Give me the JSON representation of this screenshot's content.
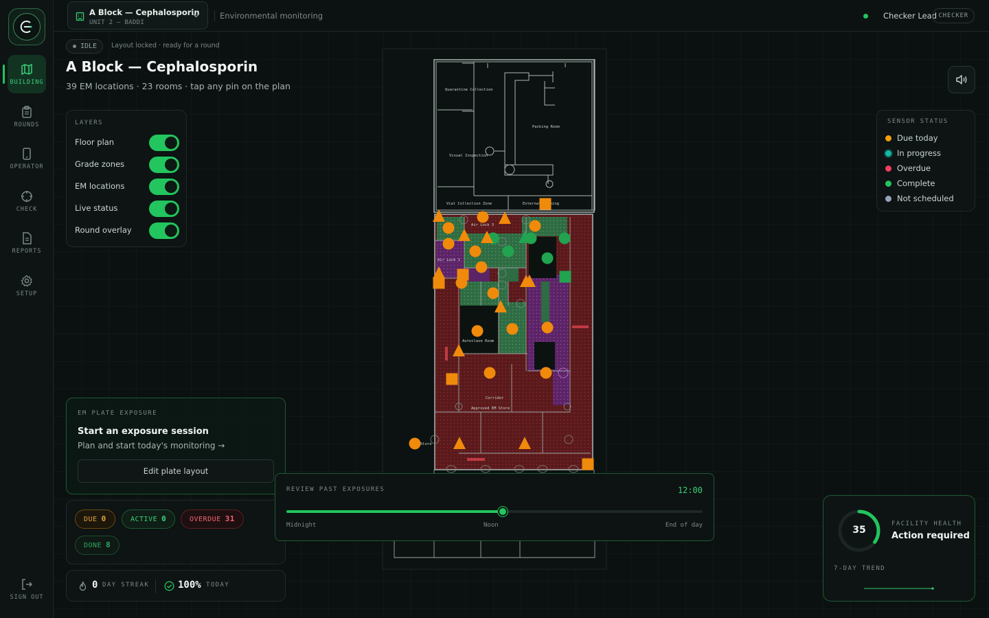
{
  "app": {
    "logo_icon": "cephalosporin-c-logo-icon"
  },
  "sidebar": {
    "items": [
      {
        "label": "BUILDING",
        "icon": "map-icon",
        "active": true
      },
      {
        "label": "ROUNDS",
        "icon": "clipboard-icon"
      },
      {
        "label": "OPERATOR",
        "icon": "phone-icon"
      },
      {
        "label": "CHECK",
        "icon": "crosshair-icon"
      },
      {
        "label": "REPORTS",
        "icon": "document-icon"
      },
      {
        "label": "SETUP",
        "icon": "gear-icon"
      }
    ],
    "signout": "SIGN OUT"
  },
  "topbar": {
    "building_name": "A Block — Cephalosporin",
    "building_sub": "UNIT 2 — BADDI",
    "module": "Environmental monitoring",
    "user": "Checker Lead",
    "role": "CHECKER"
  },
  "header": {
    "status": "IDLE",
    "status_note": "Layout locked · ready for a round",
    "title": "A Block — Cephalosporin",
    "subtitle": "39 EM locations · 23 rooms · tap any pin on the plan"
  },
  "layers": {
    "caption": "LAYERS",
    "items": [
      {
        "label": "Floor plan",
        "on": true
      },
      {
        "label": "Grade zones",
        "on": true
      },
      {
        "label": "EM locations",
        "on": true
      },
      {
        "label": "Live status",
        "on": true
      },
      {
        "label": "Round overlay",
        "on": true
      }
    ]
  },
  "legend": {
    "caption": "SENSOR STATUS",
    "items": [
      {
        "label": "Due today",
        "color": "#f59e0b"
      },
      {
        "label": "In progress",
        "color": "#14b8a6"
      },
      {
        "label": "Overdue",
        "color": "#f43f5e"
      },
      {
        "label": "Complete",
        "color": "#22c55e"
      },
      {
        "label": "Not scheduled",
        "color": "#94a3b8"
      }
    ]
  },
  "plan": {
    "rooms": {
      "quarantine": "Quarantine Collection",
      "packing": "Packing Room",
      "visual": "Visual Inspection",
      "vial": "Vial Collection Zone",
      "external": "External Washing",
      "airlock3": "Air Lock 3",
      "airlock1": "Air Lock 1",
      "autoclave": "Autoclave Room",
      "corridor": "Corridor",
      "approved": "Approved EM Store",
      "store": "Store"
    }
  },
  "exposure": {
    "caption": "EM PLATE EXPOSURE",
    "title": "Start an exposure session",
    "subtitle": "Plan and start today's monitoring →",
    "edit_button": "Edit plate layout"
  },
  "counts": {
    "due": {
      "label": "DUE",
      "value": "0"
    },
    "active": {
      "label": "ACTIVE",
      "value": "0"
    },
    "overdue": {
      "label": "OVERDUE",
      "value": "31"
    },
    "done": {
      "label": "DONE",
      "value": "8"
    }
  },
  "streak": {
    "days": "0",
    "days_label": "DAY STREAK",
    "today_pct": "100%",
    "today_label": "TODAY"
  },
  "review": {
    "caption": "REVIEW PAST EXPOSURES",
    "time": "12:00",
    "position": 0.52,
    "ticks": [
      "Midnight",
      "Noon",
      "End of day"
    ]
  },
  "health": {
    "score": "35",
    "score_fraction": 0.35,
    "caption": "FACILITY HEALTH",
    "status": "Action required",
    "trend_caption": "7-DAY TREND"
  }
}
